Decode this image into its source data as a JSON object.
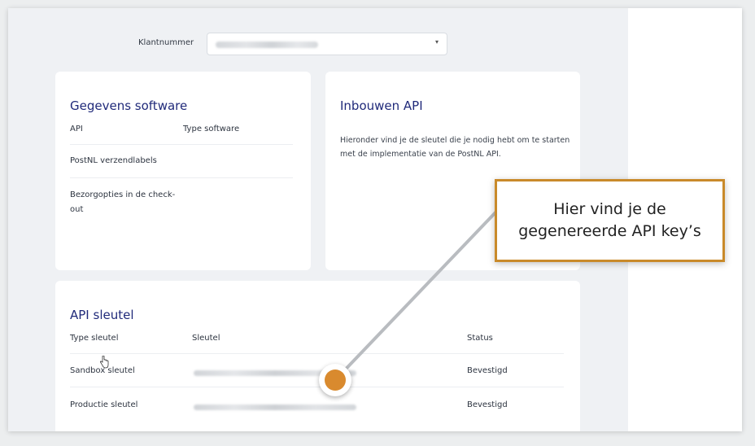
{
  "klant": {
    "label": "Klantnummer",
    "chevron": "▾"
  },
  "software": {
    "title": "Gegevens software",
    "col_api": "API",
    "col_type": "Type software",
    "row1": "PostNL verzendlabels",
    "row2_line1": "Bezorgopties in de check-",
    "row2_line2": "out"
  },
  "inbouwen": {
    "title": "Inbouwen API",
    "description": "Hieronder vind je de sleutel die je nodig hebt om te starten met de implementatie van de PostNL API."
  },
  "sleutel": {
    "title": "API sleutel",
    "headers": [
      "Type sleutel",
      "Sleutel",
      "Status"
    ],
    "rows": [
      {
        "type": "Sandbox sleutel",
        "status": "Bevestigd"
      },
      {
        "type": "Productie sleutel",
        "status": "Bevestigd"
      }
    ]
  },
  "callout": {
    "text": "Hier vind je de\ngegenereerde API key’s"
  },
  "colors": {
    "accent_orange": "#d98a2e",
    "callout_border": "#c98a2a",
    "title_blue": "#202a7a"
  }
}
